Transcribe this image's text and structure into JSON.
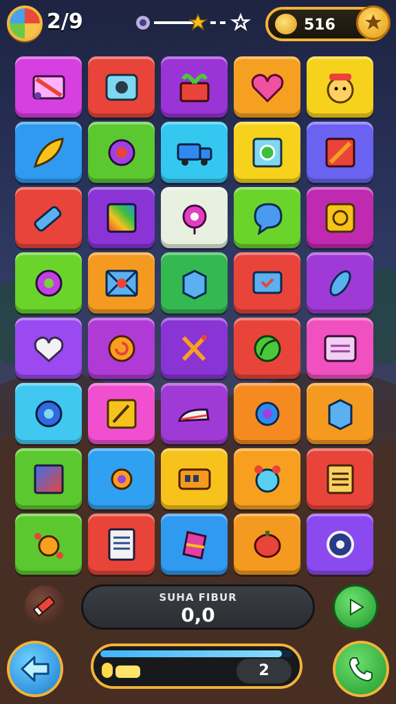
{
  "hud": {
    "level_text": "2/9",
    "coins": "516",
    "progress_fraction": 0.55
  },
  "score": {
    "label": "SUHA FIBUR",
    "value": "0,0"
  },
  "energy": {
    "fraction": 0.95,
    "count": "2"
  },
  "grid": [
    [
      {
        "color": "#d63fe0",
        "icon": "toolbox-icon"
      },
      {
        "color": "#e8443a",
        "icon": "camera-icon"
      },
      {
        "color": "#9a34d6",
        "icon": "gift-basket-icon"
      },
      {
        "color": "#f5a020",
        "icon": "heart-icon"
      },
      {
        "color": "#f7d21c",
        "icon": "cat-face-icon"
      }
    ],
    [
      {
        "color": "#2f9af0",
        "icon": "leaf-icon"
      },
      {
        "color": "#5cc830",
        "icon": "gear-icon"
      },
      {
        "color": "#34c8f0",
        "icon": "truck-icon"
      },
      {
        "color": "#f7d21c",
        "icon": "target-icon"
      },
      {
        "color": "#6a62f0",
        "icon": "arrow-icon"
      }
    ],
    [
      {
        "color": "#e8443a",
        "icon": "brush-icon"
      },
      {
        "color": "#8a34d6",
        "icon": "rainbow-card-icon"
      },
      {
        "color": "#e8f0e0",
        "icon": "donut-icon"
      },
      {
        "color": "#6ad42a",
        "icon": "chat-bubble-icon"
      },
      {
        "color": "#c02ab0",
        "icon": "coin-box-icon"
      }
    ],
    [
      {
        "color": "#6ad42a",
        "icon": "ring-icon"
      },
      {
        "color": "#f59a20",
        "icon": "envelope-icon"
      },
      {
        "color": "#34b850",
        "icon": "blue-box-icon"
      },
      {
        "color": "#e8443a",
        "icon": "heart-card-icon"
      },
      {
        "color": "#a03ad6",
        "icon": "rocket-icon"
      }
    ],
    [
      {
        "color": "#9a4af0",
        "icon": "cloud-heart-icon"
      },
      {
        "color": "#b03ad6",
        "icon": "candy-icon"
      },
      {
        "color": "#8a34d6",
        "icon": "wand-icon"
      },
      {
        "color": "#e8443a",
        "icon": "leaf-badge-icon"
      },
      {
        "color": "#f050c0",
        "icon": "window-icon"
      }
    ],
    [
      {
        "color": "#40c8f0",
        "icon": "cog-icon"
      },
      {
        "color": "#f050d0",
        "icon": "note-star-icon"
      },
      {
        "color": "#a03ad6",
        "icon": "shoe-icon"
      },
      {
        "color": "#f58a20",
        "icon": "sun-gear-icon"
      },
      {
        "color": "#f59a20",
        "icon": "cube-icon"
      }
    ],
    [
      {
        "color": "#5cc830",
        "icon": "picture-icon"
      },
      {
        "color": "#30a0f0",
        "icon": "sun-icon"
      },
      {
        "color": "#f7c21c",
        "icon": "radio-icon"
      },
      {
        "color": "#f7a020",
        "icon": "bear-icon"
      },
      {
        "color": "#e8443a",
        "icon": "list-card-icon"
      }
    ],
    [
      {
        "color": "#5cc830",
        "icon": "critter-icon"
      },
      {
        "color": "#e8443a",
        "icon": "document-icon"
      },
      {
        "color": "#2f9af0",
        "icon": "candy-bag-icon"
      },
      {
        "color": "#f59a20",
        "icon": "pumpkin-icon"
      },
      {
        "color": "#8a4af0",
        "icon": "vault-icon"
      }
    ]
  ]
}
